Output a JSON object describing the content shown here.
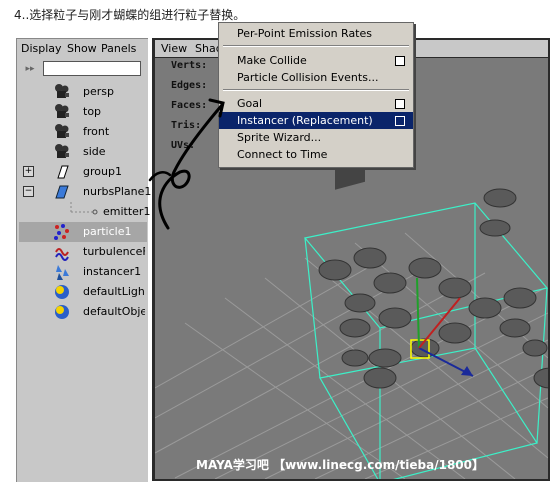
{
  "caption": "4..选择粒子与刚才蝴蝶的组进行粒子替换。",
  "outliner": {
    "menu": [
      "Display",
      "Show",
      "Panels"
    ],
    "filter_value": "",
    "items": [
      {
        "label": "persp",
        "icon": "camera-icon"
      },
      {
        "label": "top",
        "icon": "camera-icon"
      },
      {
        "label": "front",
        "icon": "camera-icon"
      },
      {
        "label": "side",
        "icon": "camera-icon"
      },
      {
        "label": "group1",
        "icon": "group-icon",
        "expander": "+"
      },
      {
        "label": "nurbsPlane1",
        "icon": "nurbs-plane-icon",
        "expander": "−"
      },
      {
        "label": "emitter1",
        "icon": "emitter-icon"
      },
      {
        "label": "particle1",
        "icon": "particle-icon",
        "selected": true
      },
      {
        "label": "turbulenceField",
        "icon": "turbulence-field-icon"
      },
      {
        "label": "instancer1",
        "icon": "instancer-icon"
      },
      {
        "label": "defaultLightSet",
        "icon": "set-icon"
      },
      {
        "label": "defaultObjectSet",
        "icon": "set-icon"
      }
    ]
  },
  "viewport": {
    "menu": [
      "View",
      "Shad"
    ],
    "hud": [
      "Verts:",
      "Edges:",
      "Faces:",
      "Tris:",
      "UVs:"
    ],
    "watermark": "MAYA学习吧 【www.linecg.com/tieba/1800】"
  },
  "menu": {
    "items": [
      {
        "label": "Per-Point Emission Rates",
        "option_box": false
      },
      {
        "label": "Make Collide",
        "option_box": true
      },
      {
        "label": "Particle Collision Events...",
        "option_box": false
      },
      {
        "label": "Goal",
        "option_box": true
      },
      {
        "label": "Instancer (Replacement)",
        "option_box": true,
        "highlighted": true
      },
      {
        "label": "Sprite Wizard...",
        "option_box": false
      },
      {
        "label": "Connect to Time",
        "option_box": false
      }
    ]
  },
  "colors": {
    "menu_highlight": "#0a246a",
    "bounding_box": "#3cf0c8",
    "selection": "#ffff00"
  }
}
